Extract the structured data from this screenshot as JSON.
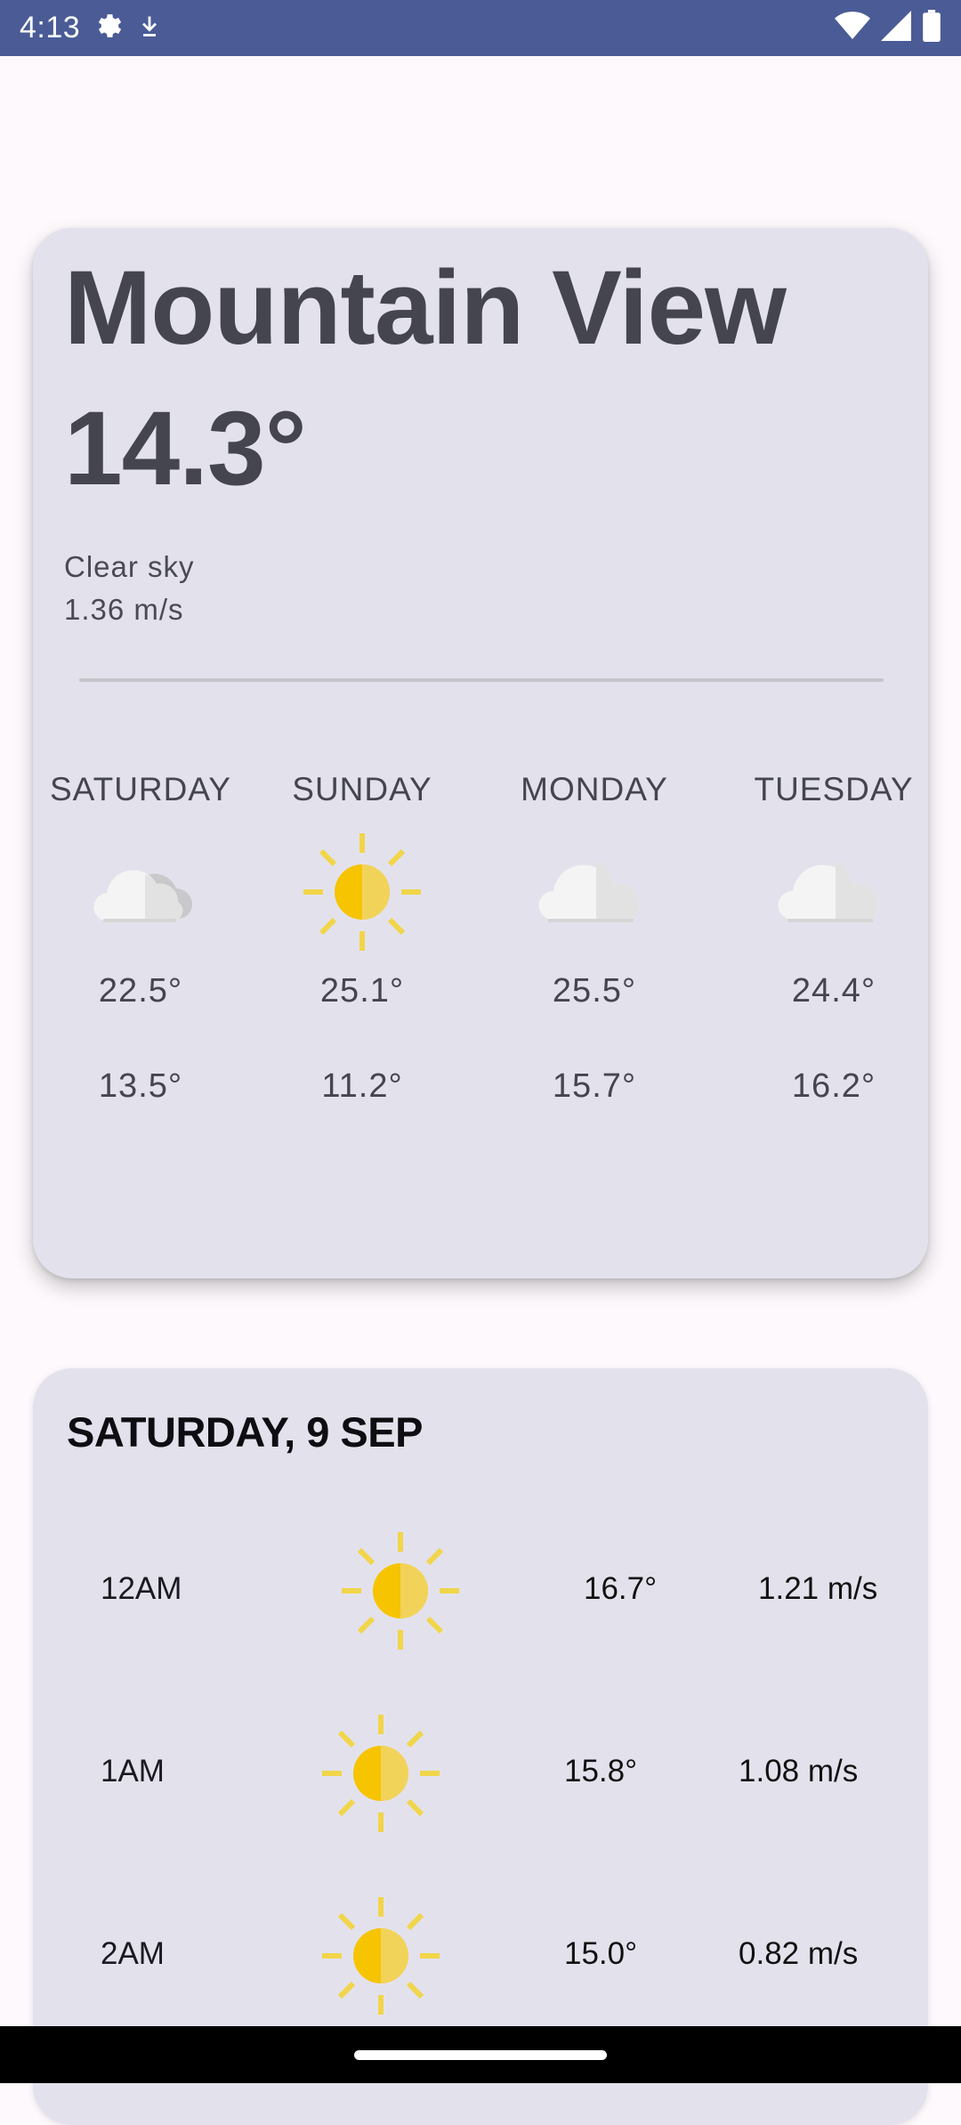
{
  "status_bar": {
    "time": "4:13",
    "icons": [
      "settings-gear-icon",
      "download-icon",
      "wifi-icon",
      "signal-icon",
      "battery-icon"
    ],
    "background": "#4a5b96"
  },
  "current": {
    "city": "Mountain View",
    "temperature": "14.3°",
    "condition": "Clear sky",
    "wind": "1.36 m/s"
  },
  "daily": [
    {
      "day": "SATURDAY",
      "icon": "partly-cloudy-icon",
      "high": "22.5°",
      "low": "13.5°"
    },
    {
      "day": "SUNDAY",
      "icon": "sun-icon",
      "high": "25.1°",
      "low": "11.2°"
    },
    {
      "day": "MONDAY",
      "icon": "cloud-icon",
      "high": "25.5°",
      "low": "15.7°"
    },
    {
      "day": "TUESDAY",
      "icon": "cloud-icon",
      "high": "24.4°",
      "low": "16.2°"
    }
  ],
  "hourly": {
    "title": "SATURDAY, 9 SEP",
    "rows": [
      {
        "time": "12AM",
        "icon": "sun-icon",
        "temp": "16.7°",
        "wind": "1.21 m/s"
      },
      {
        "time": "1AM",
        "icon": "sun-icon",
        "temp": "15.8°",
        "wind": "1.08 m/s"
      },
      {
        "time": "2AM",
        "icon": "sun-icon",
        "temp": "15.0°",
        "wind": "0.82 m/s"
      }
    ]
  },
  "colors": {
    "card": "#e3e2ec",
    "sun": "#f6c400",
    "sun_rays": "#f1d54a",
    "cloud": "#e9e9ea"
  }
}
